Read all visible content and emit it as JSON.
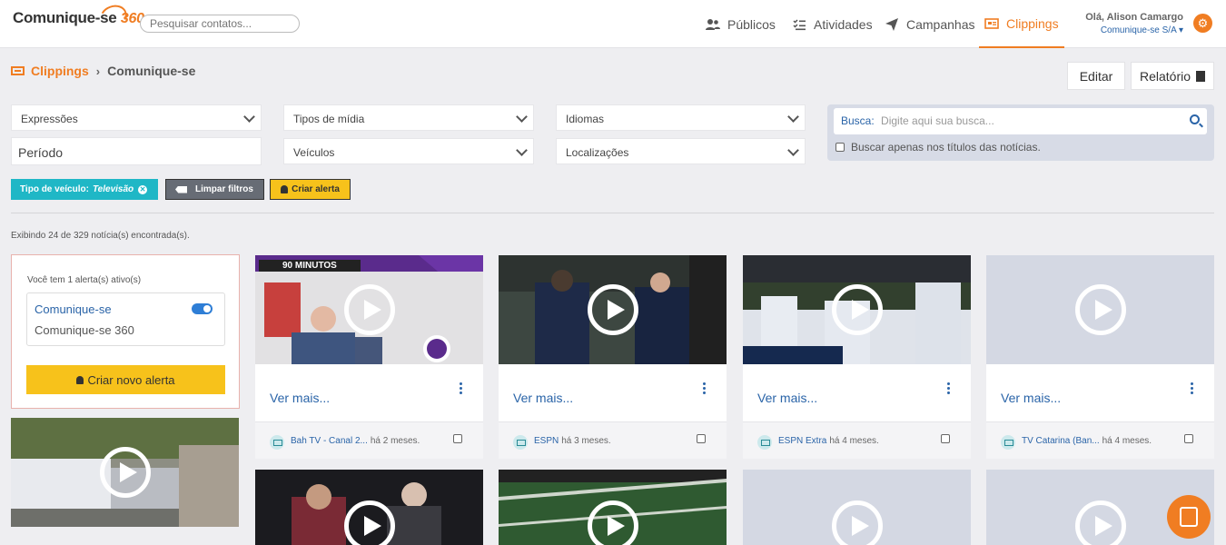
{
  "header": {
    "logo_text": "Comunique-se",
    "logo_num": "360",
    "search_placeholder": "Pesquisar contatos...",
    "nav": {
      "publicos": "Públicos",
      "atividades": "Atividades",
      "campanhas": "Campanhas",
      "clippings": "Clippings"
    },
    "user_greeting": "Olá, Alison Camargo",
    "user_org": "Comunique-se S/A ▾"
  },
  "breadcrumb": {
    "link": "Clippings",
    "current": "Comunique-se"
  },
  "actions": {
    "editar": "Editar",
    "relatorio": "Relatório"
  },
  "filters": {
    "expressoes": "Expressões",
    "tipos_midia": "Tipos de mídia",
    "idiomas": "Idiomas",
    "periodo": "Período",
    "veiculos": "Veículos",
    "localizacoes": "Localizações"
  },
  "search": {
    "label": "Busca:",
    "placeholder": "Digite aqui sua busca...",
    "titles_only": "Buscar apenas nos títulos das notícias."
  },
  "chips": {
    "tipo_label": "Tipo de veículo:",
    "tipo_value": "Televisão",
    "limpar": "Limpar filtros",
    "criar_alerta": "Criar alerta"
  },
  "results_count": "Exibindo 24 de 329 notícia(s) encontrada(s).",
  "alerts": {
    "active_text": "Você tem 1 alerta(s) ativo(s)",
    "item_name": "Comunique-se",
    "item_sub": "Comunique-se 360",
    "new_button": "Criar novo alerta"
  },
  "cards": [
    {
      "vermais": "Ver mais...",
      "source": "Bah TV - Canal 2...",
      "ago": "há 2 meses.",
      "thumb_label": "90 MINUTOS"
    },
    {
      "vermais": "Ver mais...",
      "source": "ESPN",
      "ago": "há 3 meses."
    },
    {
      "vermais": "Ver mais...",
      "source": "ESPN Extra",
      "ago": "há 4 meses."
    },
    {
      "vermais": "Ver mais...",
      "source": "TV Catarina (Ban...",
      "ago": "há 4 meses."
    }
  ],
  "colors": {
    "accent": "#f07d22",
    "link": "#2a64a8",
    "chip_teal": "#1fb7c6",
    "yellow": "#f7c21b"
  }
}
